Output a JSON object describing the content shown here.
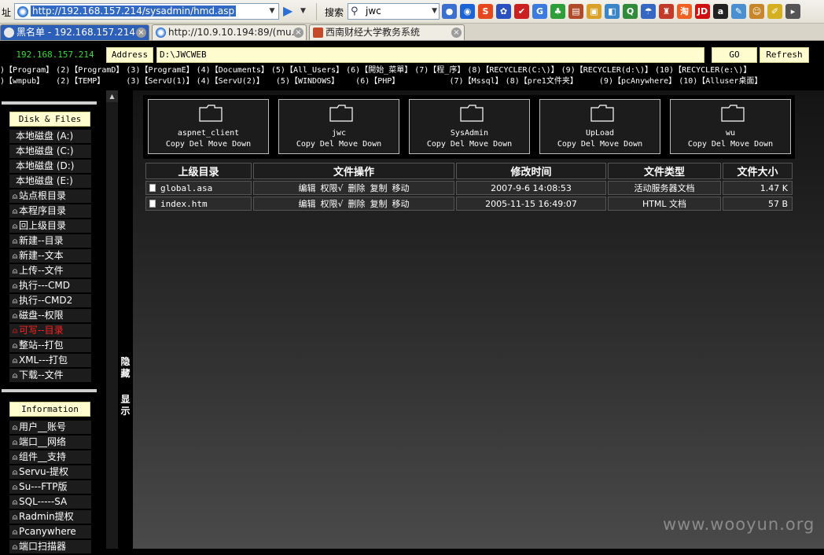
{
  "browser": {
    "address_label": "址",
    "url": "http://192.168.157.214/sysadmin/hmd.asp",
    "search_label": "搜索",
    "search_value": "jwc",
    "toolbar_icons": [
      {
        "name": "globe-icon",
        "glyph": "●",
        "color": "#3a6fd0"
      },
      {
        "name": "zoom-icon",
        "glyph": "◉",
        "color": "#1c64d6"
      },
      {
        "name": "sohu-icon",
        "glyph": "S",
        "color": "#e5481f"
      },
      {
        "name": "baidu-icon",
        "glyph": "✿",
        "color": "#2b4fbf"
      },
      {
        "name": "check-icon",
        "glyph": "✔",
        "color": "#cc2020"
      },
      {
        "name": "google-icon",
        "glyph": "G",
        "color": "#3c7ae0"
      },
      {
        "name": "clover-icon",
        "glyph": "♣",
        "color": "#2e9e3a"
      },
      {
        "name": "book-icon",
        "glyph": "▤",
        "color": "#b04a2a"
      },
      {
        "name": "photo-icon",
        "glyph": "▣",
        "color": "#d9a02a"
      },
      {
        "name": "image-icon",
        "glyph": "◧",
        "color": "#3a86c9"
      },
      {
        "name": "qq-icon",
        "glyph": "Q",
        "color": "#2f8a3a"
      },
      {
        "name": "weather-icon",
        "glyph": "☂",
        "color": "#3466c2"
      },
      {
        "name": "shop-icon",
        "glyph": "♜",
        "color": "#c23a2a"
      },
      {
        "name": "taobao-icon",
        "glyph": "淘",
        "color": "#f06020"
      },
      {
        "name": "jd-icon",
        "glyph": "JD",
        "color": "#d01010"
      },
      {
        "name": "amazon-icon",
        "glyph": "a",
        "color": "#222222"
      },
      {
        "name": "edit-icon",
        "glyph": "✎",
        "color": "#4a90d0"
      },
      {
        "name": "face-icon",
        "glyph": "☺",
        "color": "#c8862a"
      },
      {
        "name": "pencil-icon",
        "glyph": "✐",
        "color": "#d4b020"
      },
      {
        "name": "arrow-icon",
        "glyph": "▸",
        "color": "#555555"
      }
    ],
    "tabs": [
      {
        "title": "黑名单 - 192.168.157.214",
        "active": true
      },
      {
        "title": "http://10.9.10.194:89/(mu...",
        "active": false
      },
      {
        "title": "西南财经大学教务系统",
        "active": false
      }
    ]
  },
  "pathbar": {
    "ip": "192.168.157.214",
    "address_label": "Address",
    "path_value": "D:\\JWCWEB",
    "go_label": "GO",
    "refresh_label": "Refresh"
  },
  "quick_links": {
    "row1": [
      ")【Program】",
      "(2)【ProgramD】",
      "(3)【ProgramE】",
      "(4)【Documents】",
      "(5)【All_Users】",
      "(6)【開始_菜單】",
      "(7)【程_序】",
      "(8)【RECYCLER(C:\\)】",
      "(9)【RECYCLER(d:\\)】",
      "(10)【RECYCLER(e:\\)】"
    ],
    "row2": [
      ")【wmpub】",
      "  (2)【TEMP】",
      "    (3)【ServU(1)】",
      "(4)【ServU(2)】",
      "  (5)【WINDOWS】",
      "   (6)【PHP】",
      "          (7)【Mssql】",
      "(8)【pre1文件夹】",
      "    (9)【pcAnywhere】",
      "(10)【Alluser桌面】"
    ]
  },
  "sidebar": {
    "files_heading": "Disk & Files",
    "disks": [
      "本地磁盘 (A:)",
      "本地磁盘 (C:)",
      "本地磁盘 (D:)",
      "本地磁盘 (E:)"
    ],
    "actions": [
      {
        "label": "站点根目录",
        "red": false
      },
      {
        "label": "本程序目录",
        "red": false
      },
      {
        "label": "回上级目录",
        "red": false
      },
      {
        "label": "新建--目录",
        "red": false
      },
      {
        "label": "新建--文本",
        "red": false
      },
      {
        "label": "上传--文件",
        "red": false
      },
      {
        "label": "执行---CMD",
        "red": false
      },
      {
        "label": "执行--CMD2",
        "red": false
      },
      {
        "label": "磁盘--权限",
        "red": false
      },
      {
        "label": "可写--目录",
        "red": true
      },
      {
        "label": "整站--打包",
        "red": false
      },
      {
        "label": "XML---打包",
        "red": false
      },
      {
        "label": "下载--文件",
        "red": false
      }
    ],
    "info_heading": "Information",
    "info_items": [
      "用户__账号",
      "端口__网络",
      "组件__支持",
      "Servu-提权",
      "Su---FTP版",
      "SQL-----SA",
      "Radmin提权",
      "Pcanywhere",
      "端口扫描器"
    ]
  },
  "toggle": {
    "hide_label_1": "隐",
    "hide_label_2": "藏",
    "show_label_1": "显",
    "show_label_2": "示"
  },
  "folders": [
    {
      "name": "aspnet_client",
      "actions": "Copy Del Move Down"
    },
    {
      "name": "jwc",
      "actions": "Copy Del Move Down"
    },
    {
      "name": "SysAdmin",
      "actions": "Copy Del Move Down"
    },
    {
      "name": "UpLoad",
      "actions": "Copy Del Move Down"
    },
    {
      "name": "wu",
      "actions": "Copy Del Move Down"
    }
  ],
  "file_table": {
    "headers": {
      "name": "上级目录",
      "ops": "文件操作",
      "time": "修改时间",
      "type": "文件类型",
      "size": "文件大小"
    },
    "ops_labels": [
      "编辑",
      "权限√",
      "删除",
      "复制",
      "移动"
    ],
    "rows": [
      {
        "name": "global.asa",
        "time": "2007-9-6 14:08:53",
        "type": "活动服务器文档",
        "size": "1.47 K"
      },
      {
        "name": "index.htm",
        "time": "2005-11-15 16:49:07",
        "type": "HTML 文档",
        "size": "57 B"
      }
    ]
  },
  "watermark": "www.wooyun.org",
  "colors": {
    "ip_green": "#33dd33",
    "button_yellow": "#fffdd0",
    "warning_red": "#ff2020",
    "selection_blue": "#316ac5"
  }
}
